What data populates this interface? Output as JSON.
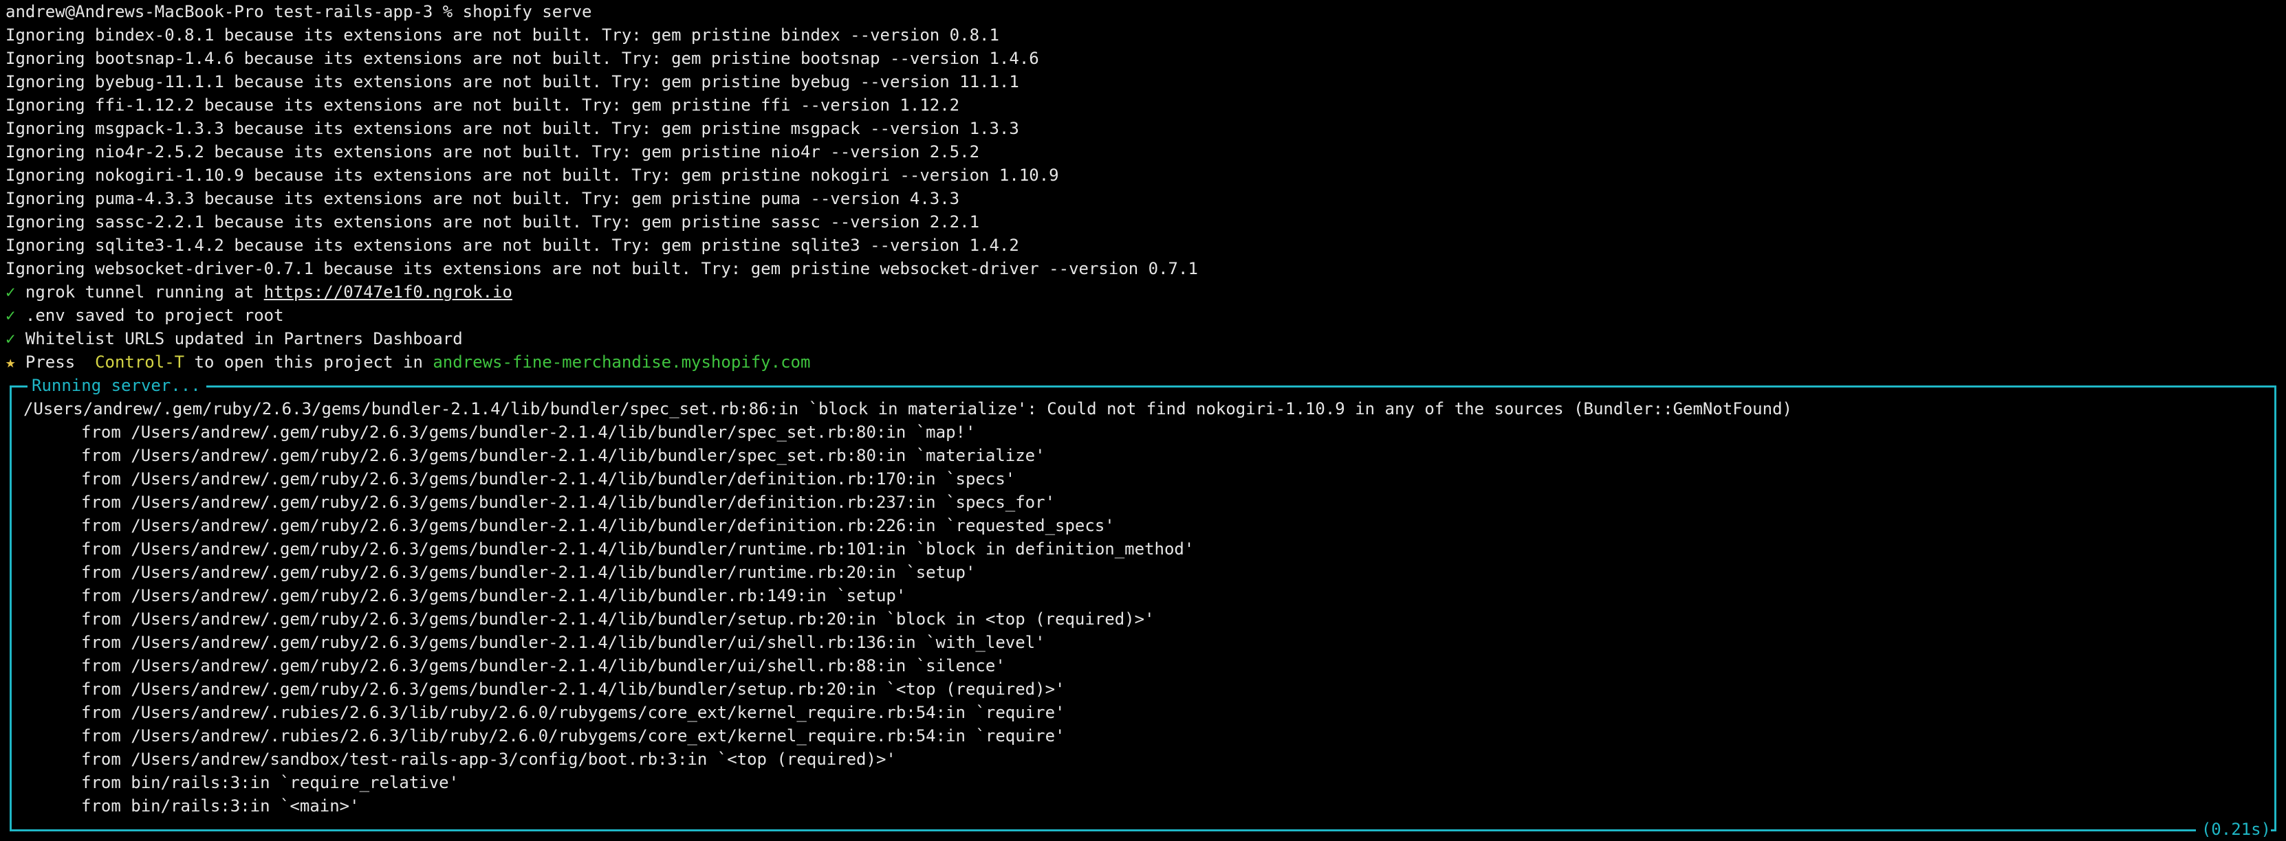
{
  "prompt": {
    "text": "andrew@Andrews-MacBook-Pro test-rails-app-3 % shopify serve"
  },
  "warnings": [
    "Ignoring bindex-0.8.1 because its extensions are not built. Try: gem pristine bindex --version 0.8.1",
    "Ignoring bootsnap-1.4.6 because its extensions are not built. Try: gem pristine bootsnap --version 1.4.6",
    "Ignoring byebug-11.1.1 because its extensions are not built. Try: gem pristine byebug --version 11.1.1",
    "Ignoring ffi-1.12.2 because its extensions are not built. Try: gem pristine ffi --version 1.12.2",
    "Ignoring msgpack-1.3.3 because its extensions are not built. Try: gem pristine msgpack --version 1.3.3",
    "Ignoring nio4r-2.5.2 because its extensions are not built. Try: gem pristine nio4r --version 2.5.2",
    "Ignoring nokogiri-1.10.9 because its extensions are not built. Try: gem pristine nokogiri --version 1.10.9",
    "Ignoring puma-4.3.3 because its extensions are not built. Try: gem pristine puma --version 4.3.3",
    "Ignoring sassc-2.2.1 because its extensions are not built. Try: gem pristine sassc --version 2.2.1",
    "Ignoring sqlite3-1.4.2 because its extensions are not built. Try: gem pristine sqlite3 --version 1.4.2",
    "Ignoring websocket-driver-0.7.1 because its extensions are not built. Try: gem pristine websocket-driver --version 0.7.1"
  ],
  "status": {
    "check_glyph": "✓",
    "star_glyph": "★",
    "ngrok_text": " ngrok tunnel running at ",
    "ngrok_url": "https://0747e1f0.ngrok.io",
    "env_text": " .env saved to project root",
    "whitelist_text": " Whitelist URLS updated in Partners Dashboard",
    "press_text": " Press ",
    "press_key": "Control-T",
    "press_middle": " to open this project in ",
    "shop_domain": "andrews-fine-merchandise.myshopify.com"
  },
  "server_frame": {
    "title": "Running server...",
    "elapsed": "(0.21s)",
    "error": "/Users/andrew/.gem/ruby/2.6.3/gems/bundler-2.1.4/lib/bundler/spec_set.rb:86:in `block in materialize': Could not find nokogiri-1.10.9 in any of the sources (Bundler::GemNotFound)",
    "trace": [
      "from /Users/andrew/.gem/ruby/2.6.3/gems/bundler-2.1.4/lib/bundler/spec_set.rb:80:in `map!'",
      "from /Users/andrew/.gem/ruby/2.6.3/gems/bundler-2.1.4/lib/bundler/spec_set.rb:80:in `materialize'",
      "from /Users/andrew/.gem/ruby/2.6.3/gems/bundler-2.1.4/lib/bundler/definition.rb:170:in `specs'",
      "from /Users/andrew/.gem/ruby/2.6.3/gems/bundler-2.1.4/lib/bundler/definition.rb:237:in `specs_for'",
      "from /Users/andrew/.gem/ruby/2.6.3/gems/bundler-2.1.4/lib/bundler/definition.rb:226:in `requested_specs'",
      "from /Users/andrew/.gem/ruby/2.6.3/gems/bundler-2.1.4/lib/bundler/runtime.rb:101:in `block in definition_method'",
      "from /Users/andrew/.gem/ruby/2.6.3/gems/bundler-2.1.4/lib/bundler/runtime.rb:20:in `setup'",
      "from /Users/andrew/.gem/ruby/2.6.3/gems/bundler-2.1.4/lib/bundler.rb:149:in `setup'",
      "from /Users/andrew/.gem/ruby/2.6.3/gems/bundler-2.1.4/lib/bundler/setup.rb:20:in `block in <top (required)>'",
      "from /Users/andrew/.gem/ruby/2.6.3/gems/bundler-2.1.4/lib/bundler/ui/shell.rb:136:in `with_level'",
      "from /Users/andrew/.gem/ruby/2.6.3/gems/bundler-2.1.4/lib/bundler/ui/shell.rb:88:in `silence'",
      "from /Users/andrew/.gem/ruby/2.6.3/gems/bundler-2.1.4/lib/bundler/setup.rb:20:in `<top (required)>'",
      "from /Users/andrew/.rubies/2.6.3/lib/ruby/2.6.0/rubygems/core_ext/kernel_require.rb:54:in `require'",
      "from /Users/andrew/.rubies/2.6.3/lib/ruby/2.6.0/rubygems/core_ext/kernel_require.rb:54:in `require'",
      "from /Users/andrew/sandbox/test-rails-app-3/config/boot.rb:3:in `<top (required)>'",
      "from bin/rails:3:in `require_relative'",
      "from bin/rails:3:in `<main>'"
    ]
  },
  "colors": {
    "background": "#000000",
    "text": "#e6e6e6",
    "success": "#3fc43f",
    "frame": "#1fb7c6",
    "key": "#d5d545",
    "star": "#e8c547"
  }
}
